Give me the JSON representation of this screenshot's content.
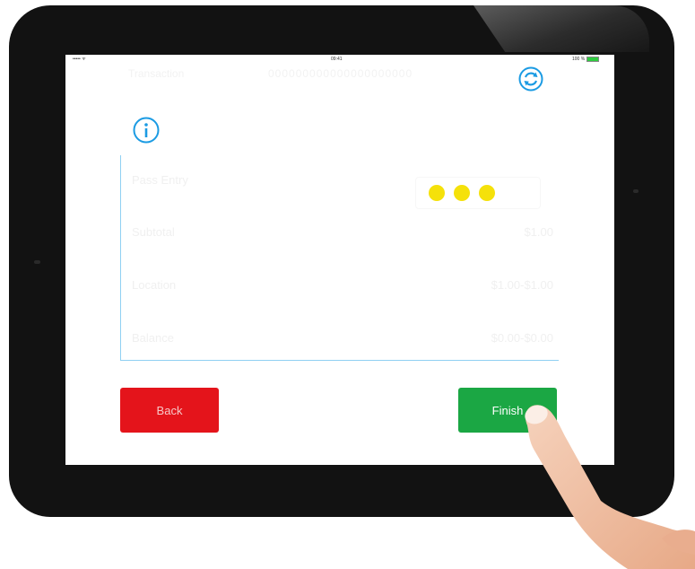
{
  "status_bar": {
    "signal": "••••• ᯤ",
    "time": "09:41",
    "battery_text": "100 %"
  },
  "header": {
    "title": "Transaction",
    "transaction_id": "000000000000000000000"
  },
  "panel": {
    "rows": [
      {
        "label": "Pass Entry",
        "value": ""
      },
      {
        "label": "Subtotal",
        "value": "$1.00"
      },
      {
        "label": "Location",
        "value": "$1.00-$1.00"
      },
      {
        "label": "Balance",
        "value": "$0.00-$0.00"
      }
    ]
  },
  "buttons": {
    "back": "Back",
    "finish": "Finish"
  },
  "colors": {
    "accent": "#1b9be3",
    "back": "#e4141b",
    "finish": "#1ba744",
    "dots": "#f5e10a"
  },
  "icons": {
    "refresh": "refresh-icon",
    "info": "info-icon"
  }
}
